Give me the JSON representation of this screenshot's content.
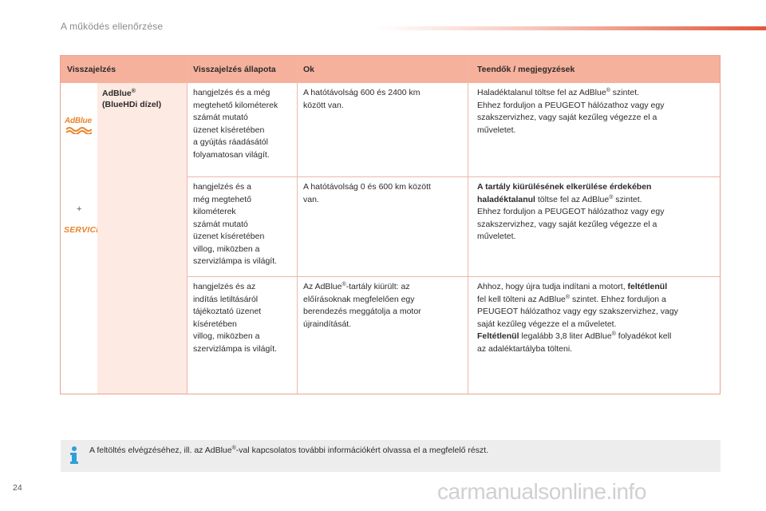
{
  "header": {
    "title": "A működés ellenőrzése"
  },
  "table": {
    "headers": [
      "Visszajelzés",
      "Visszajelzés állapota",
      "Ok",
      "Teendők / megjegyzések"
    ],
    "icons": {
      "adblue": "AdBlue",
      "plus": "+",
      "service": "SERVICE"
    },
    "label_line1": "AdBlue",
    "label_sup": "®",
    "label_line2": "(BlueHDi dízel)",
    "rows": [
      {
        "state": [
          "hangjelzés és a még",
          "megtehető kilométerek",
          "számát mutató",
          "üzenet kíséretében",
          "a gyújtás ráadásától",
          "folyamatosan világít."
        ],
        "cause": [
          "A hatótávolság 600 és 2400 km",
          "között van."
        ],
        "action_l1_a": "Haladéktalanul töltse fel az AdBlue",
        "action_l1_b": " szintet.",
        "action_rest": [
          "Ehhez forduljon a PEUGEOT hálózathoz vagy egy",
          "szakszervizhez, vagy saját kezűleg végezze el a",
          "műveletet."
        ]
      },
      {
        "state": [
          "hangjelzés és a",
          "még megtehető",
          "kilométerek",
          "számát mutató",
          "üzenet kíséretében",
          "villog, miközben a",
          "szervizlámpa is világít."
        ],
        "cause": [
          "A hatótávolság 0 és 600 km között",
          "van."
        ],
        "action_bold1": "A tartály kiürülésének elkerülése érdekében",
        "action_bold2": "haladéktalanul",
        "action_l2_b": " töltse fel az AdBlue",
        "action_l2_c": " szintet.",
        "action_rest": [
          "Ehhez forduljon a PEUGEOT hálózathoz vagy egy",
          "szakszervizhez, vagy saját kezűleg végezze el a",
          "műveletet."
        ]
      },
      {
        "state": [
          "hangjelzés és az",
          "indítás letiltásáról",
          "tájékoztató üzenet",
          "kíséretében",
          "villog, miközben a",
          "szervizlámpa is világít."
        ],
        "cause_l1_a": "Az AdBlue",
        "cause_l1_b": "-tartály kiürült: az",
        "cause_rest": [
          "előírásoknak megfelelően egy",
          "berendezés meggátolja a motor",
          "újraindítását."
        ],
        "action_l1_a": "Ahhoz, hogy újra tudja indítani a motort, ",
        "action_l1_bold": "feltétlenül",
        "action_l2_a": "fel kell tölteni az AdBlue",
        "action_l2_b": " szintet. Ehhez forduljon a",
        "action_l3": "PEUGEOT hálózathoz vagy egy szakszervizhez, vagy",
        "action_l4": "saját kezűleg végezze el a műveletet.",
        "action_l5_bold": "Feltétlenül",
        "action_l5_a": " legalább 3,8 liter AdBlue",
        "action_l5_b": " folyadékot kell",
        "action_l6": "az adaléktartályba tölteni."
      }
    ]
  },
  "note": {
    "text_a": "A feltöltés elvégzéséhez, ill. az AdBlue",
    "text_b": "-val kapcsolatos további információkért olvassa el a megfelelő részt."
  },
  "page_number": "24",
  "watermark": "carmanualsonline.info",
  "colors": {
    "accent": "#e2573a",
    "header_bg": "#f6b19d",
    "label_bg": "#fdeae3",
    "icon_orange": "#e9852c"
  }
}
